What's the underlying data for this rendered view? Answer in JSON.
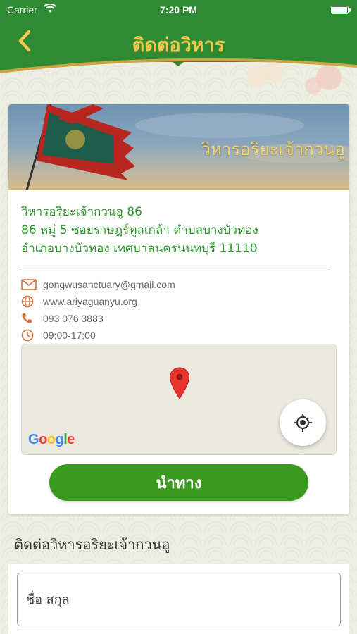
{
  "status_bar": {
    "carrier": "Carrier",
    "time": "7:20 PM"
  },
  "nav": {
    "title": "ติดต่อวิหาร",
    "back_icon": "chevron-left-icon"
  },
  "banner": {
    "title": "วิหารอริยะเจ้ากวนอู"
  },
  "address": {
    "line1": "วิหารอริยะเจ้ากวนอู 86",
    "line2": "86 หมู่ 5 ซอยราษฎร์ทูลเกล้า ตำบลบางบัวทอง",
    "line3": "อำเภอบางบัวทอง เทศบาลนครนนทบุรี 11110"
  },
  "contact": {
    "email": "gongwusanctuary@gmail.com",
    "website": "www.ariyaguanyu.org",
    "phone": "093 076 3883",
    "hours": "09:00-17:00"
  },
  "map": {
    "provider": "Google"
  },
  "navigate_button": "นำทาง",
  "form": {
    "section_title": "ติดต่อวิหารอริยะเจ้ากวนอู",
    "name_placeholder": "ชื่อ สกุล"
  },
  "colors": {
    "primary_green": "#2f8a34",
    "button_green": "#3a9a1f",
    "gold": "#f2c94c",
    "address_green": "#2e9a2e",
    "icon_orange": "#d9703a"
  }
}
